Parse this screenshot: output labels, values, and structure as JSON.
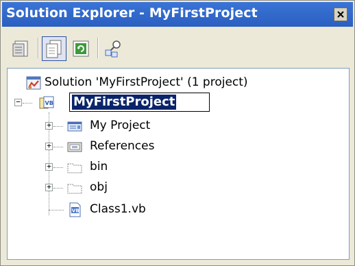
{
  "window": {
    "title": "Solution Explorer - MyFirstProject",
    "close_glyph": "✕"
  },
  "toolbar": {
    "buttons": [
      {
        "icon": "properties-icon",
        "active": false
      },
      {
        "icon": "show-all-files-icon",
        "active": true
      },
      {
        "icon": "refresh-icon",
        "active": false
      },
      {
        "icon": "view-class-diagram-icon",
        "active": false
      }
    ]
  },
  "tree": {
    "solution_label": "Solution 'MyFirstProject' (1 project)",
    "project_label": "MyFirstProject",
    "items": [
      {
        "label": "My Project",
        "icon": "my-project-icon",
        "expandable": true
      },
      {
        "label": "References",
        "icon": "references-icon",
        "expandable": true
      },
      {
        "label": "bin",
        "icon": "folder-icon",
        "expandable": true
      },
      {
        "label": "obj",
        "icon": "folder-icon",
        "expandable": true
      },
      {
        "label": "Class1.vb",
        "icon": "vb-file-icon",
        "expandable": false
      }
    ]
  },
  "colors": {
    "title_bar": "#2a5fc0",
    "selection": "#0a246a",
    "panel": "#ece9d8"
  }
}
